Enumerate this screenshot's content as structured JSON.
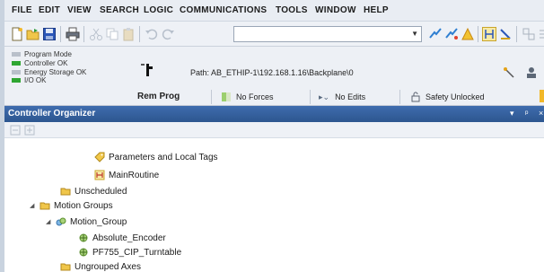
{
  "menu": [
    "FILE",
    "EDIT",
    "VIEW",
    "SEARCH",
    "LOGIC",
    "COMMUNICATIONS",
    "TOOLS",
    "WINDOW",
    "HELP"
  ],
  "toolbar": {
    "combo_value": "",
    "icons": [
      "new-icon",
      "open-icon",
      "save-icon",
      "print-icon",
      "cut-icon",
      "copy-icon",
      "paste-icon",
      "undo-icon",
      "redo-icon"
    ]
  },
  "status": {
    "lines": [
      "Program Mode",
      "Controller OK",
      "Energy Storage OK",
      "I/O OK"
    ],
    "path_label": "Path: AB_ETHIP-1\\192.168.1.16\\Backplane\\0",
    "mode": "Rem Prog",
    "forces": "No Forces",
    "edits": "No Edits",
    "safety": "Safety Unlocked",
    "colors": {
      "ok": "#2fa632",
      "mode": "#3b7a3b"
    }
  },
  "organizer": {
    "title": "Controller Organizer",
    "pin": "▾",
    "close": "ᵖ"
  },
  "tree": [
    {
      "label": "Parameters and Local Tags",
      "icon": "tag-icon"
    },
    {
      "label": "MainRoutine",
      "icon": "routine-icon"
    },
    {
      "label": "Unscheduled",
      "icon": "folder-icon"
    },
    {
      "label": "Motion Groups",
      "icon": "folder-icon"
    },
    {
      "label": "Motion_Group",
      "icon": "motion-group-icon"
    },
    {
      "label": "Absolute_Encoder",
      "icon": "axis-icon"
    },
    {
      "label": "PF755_CIP_Turntable",
      "icon": "axis-icon"
    },
    {
      "label": "Ungrouped Axes",
      "icon": "folder-icon"
    }
  ]
}
